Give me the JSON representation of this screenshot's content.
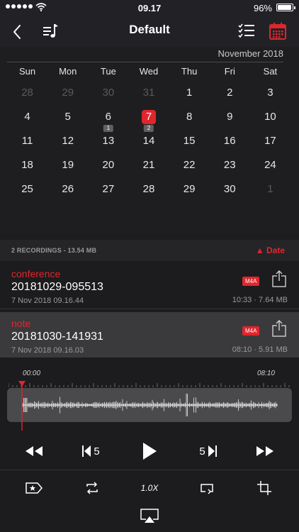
{
  "status_bar": {
    "time": "09.17",
    "battery_percent": "96%",
    "signal_bars": 5,
    "battery_level": 0.96
  },
  "nav": {
    "title": "Default"
  },
  "calendar": {
    "month": "November 2018",
    "weekdays": [
      "Sun",
      "Mon",
      "Tue",
      "Wed",
      "Thu",
      "Fri",
      "Sat"
    ],
    "weeks": [
      [
        {
          "d": "28",
          "muted": true
        },
        {
          "d": "29",
          "muted": true
        },
        {
          "d": "30",
          "muted": true
        },
        {
          "d": "31",
          "muted": true
        },
        {
          "d": "1"
        },
        {
          "d": "2"
        },
        {
          "d": "3"
        }
      ],
      [
        {
          "d": "4"
        },
        {
          "d": "5"
        },
        {
          "d": "6",
          "badge": "1"
        },
        {
          "d": "7",
          "badge": "2",
          "selected": true
        },
        {
          "d": "8"
        },
        {
          "d": "9"
        },
        {
          "d": "10"
        }
      ],
      [
        {
          "d": "11"
        },
        {
          "d": "12"
        },
        {
          "d": "13"
        },
        {
          "d": "14"
        },
        {
          "d": "15"
        },
        {
          "d": "16"
        },
        {
          "d": "17"
        }
      ],
      [
        {
          "d": "18"
        },
        {
          "d": "19"
        },
        {
          "d": "20"
        },
        {
          "d": "21"
        },
        {
          "d": "22"
        },
        {
          "d": "23"
        },
        {
          "d": "24"
        }
      ],
      [
        {
          "d": "25"
        },
        {
          "d": "26"
        },
        {
          "d": "27"
        },
        {
          "d": "28"
        },
        {
          "d": "29"
        },
        {
          "d": "30"
        },
        {
          "d": "1",
          "muted": true
        }
      ]
    ]
  },
  "list": {
    "count_label": "2 RECORDINGS",
    "size_label": "13.54 MB",
    "sort_label": "▲ Date"
  },
  "recordings": [
    {
      "label": "conference",
      "name": "20181029-095513",
      "date": "7 Nov 2018 09.16.44",
      "format": "M4A",
      "duration": "10:33",
      "size": "7.64 MB"
    },
    {
      "label": "note",
      "name": "20181030-141931",
      "date": "7 Nov 2018 09.16.03",
      "format": "M4A",
      "duration": "08:10",
      "size": "5.91 MB"
    }
  ],
  "player": {
    "time_start": "00:00",
    "time_end": "08:10",
    "skip_back_seconds": "5",
    "skip_forward_seconds": "5",
    "speed": "1.0X"
  },
  "colors": {
    "accent": "#e0262d",
    "background": "#1c1c1e",
    "bar": "#222226",
    "selected_row": "#3a3a3c"
  }
}
